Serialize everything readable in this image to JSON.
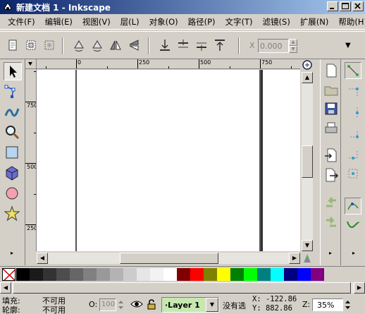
{
  "window": {
    "title": "新建文档 1 - Inkscape"
  },
  "menu": [
    "文件(F)",
    "编辑(E)",
    "视图(V)",
    "层(L)",
    "对象(O)",
    "路径(P)",
    "文字(T)",
    "滤镜(S)",
    "扩展(N)",
    "帮助(H)"
  ],
  "toolbar": {
    "x_label": "X",
    "x_value": "0.000"
  },
  "rulers": {
    "top": [
      "0",
      "250",
      "500",
      "750"
    ],
    "left": [
      "750",
      "500",
      "250"
    ]
  },
  "palette": {
    "colors": [
      "#000000",
      "#1a1a1a",
      "#333333",
      "#4d4d4d",
      "#666666",
      "#808080",
      "#999999",
      "#b3b3b3",
      "#cccccc",
      "#e6e6e6",
      "#f2f2f2",
      "#ffffff",
      "#800000",
      "#ff0000",
      "#808000",
      "#ffff00",
      "#008000",
      "#00ff00",
      "#008080",
      "#00ffff",
      "#000080",
      "#0000ff",
      "#800080"
    ]
  },
  "status": {
    "fill_label": "填充:",
    "fill_value": "不可用",
    "stroke_label": "轮廓:",
    "stroke_value": "不可用",
    "opacity_label": "O:",
    "opacity_value": "100",
    "layer": "·Layer 1",
    "message": "没有选",
    "x_coord": "X: -122.86",
    "y_coord": "Y:  882.86",
    "zoom_label": "Z:",
    "zoom_value": "35%"
  }
}
